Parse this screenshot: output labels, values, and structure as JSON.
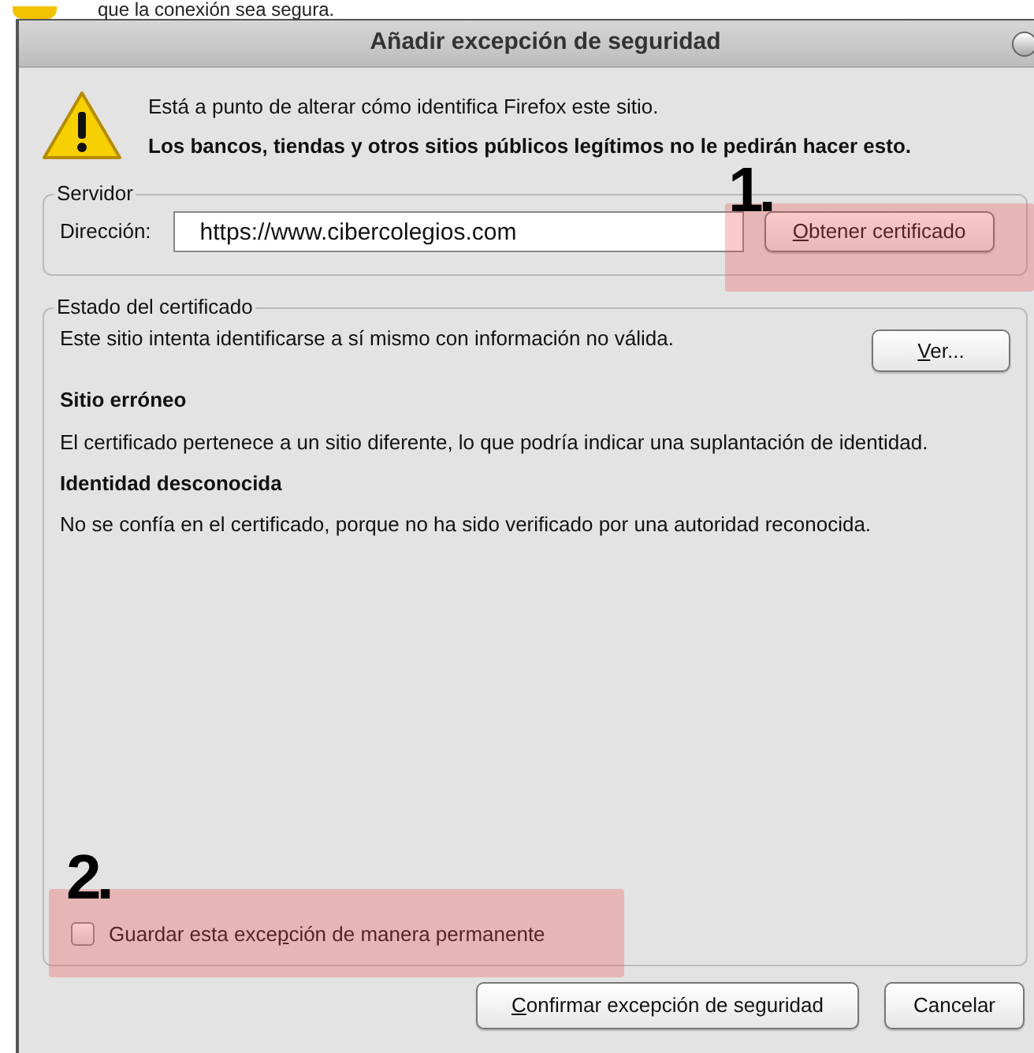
{
  "background_text": "que la conexión sea segura.",
  "window": {
    "title": "Añadir excepción de seguridad"
  },
  "warning": {
    "line_1": "Está a punto de alterar cómo identifica Firefox este sitio.",
    "line_2": "Los bancos, tiendas y otros sitios públicos legítimos no le pedirán hacer esto."
  },
  "server": {
    "legend": "Servidor",
    "address_label": "Dirección:",
    "address_value": "https://www.cibercolegios.com",
    "get_button": {
      "key": "O",
      "after": "btener certificado"
    }
  },
  "status": {
    "legend": "Estado del certificado",
    "summary": "Este sitio intenta identificarse a sí mismo con información no válida.",
    "view_button": {
      "key": "V",
      "after": "er..."
    },
    "sections": [
      {
        "heading": "Sitio erróneo",
        "text": "El certificado pertenece a un sitio diferente, lo que podría indicar una suplantación de identidad."
      },
      {
        "heading": "Identidad desconocida",
        "text": "No se confía en el certificado, porque no ha sido verificado por una autoridad reconocida."
      }
    ]
  },
  "permanent": {
    "checked": false,
    "label": {
      "before": "Guardar esta exce",
      "key": "p",
      "after": "ción de manera permanente"
    }
  },
  "buttons": [
    {
      "key": "C",
      "after": "onfirmar excepción de seguridad"
    },
    {
      "before": "Cancelar"
    }
  ],
  "annotations": [
    {
      "label": "1."
    },
    {
      "label": "2."
    }
  ]
}
